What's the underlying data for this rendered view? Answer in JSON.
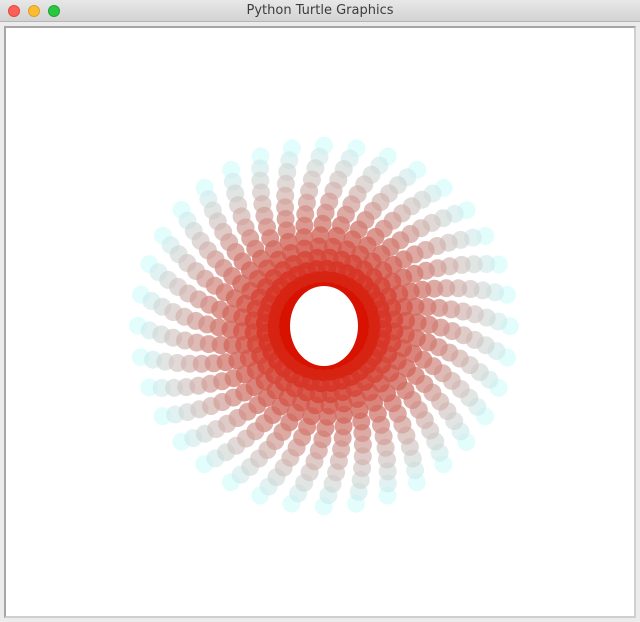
{
  "window": {
    "title": "Python Turtle Graphics"
  },
  "drawing": {
    "background_color": "#ffffff",
    "color_inner": "#d81200",
    "color_outer": "#ccfbfb",
    "spoke_count": 36,
    "steps_per_spoke": 14
  }
}
